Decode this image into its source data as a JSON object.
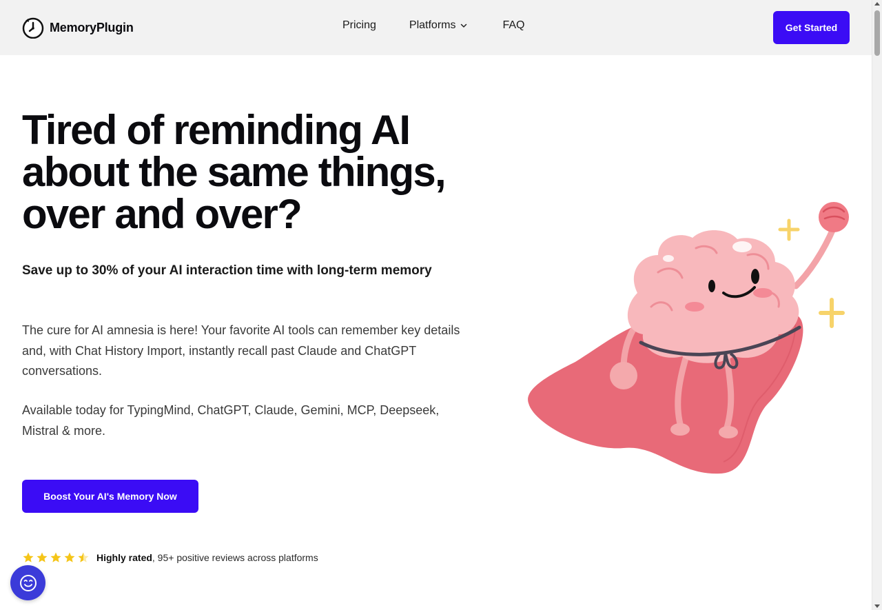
{
  "header": {
    "logo_text": "MemoryPlugin",
    "nav": {
      "pricing": "Pricing",
      "platforms": "Platforms",
      "faq": "FAQ"
    },
    "cta_label": "Get Started"
  },
  "hero": {
    "title_lines": [
      "Tired of reminding AI",
      "about the same things,",
      "over and over?"
    ],
    "subtitle": "Save up to 30% of your AI interaction time with long-term memory",
    "description": "The cure for AI amnesia is here! Your favorite AI tools can remember key details and, with Chat History Import, instantly recall past Claude and ChatGPT conversations.",
    "availability": "Available today for TypingMind, ChatGPT, Claude, Gemini, MCP, Deepseek, Mistral & more.",
    "cta_label": "Boost Your AI's Memory Now"
  },
  "rating": {
    "stars_value": 4.5,
    "stars_max": 5,
    "bold_text": "Highly rated",
    "rest_text": ", 95+ positive reviews across platforms"
  },
  "icons": {
    "logo": "stopwatch-icon",
    "platforms_chevron": "chevron-down-icon",
    "star": "star-icon",
    "chat": "smiley-chat-icon"
  },
  "colors": {
    "accent": "#3b0cf5",
    "header_bg": "#f2f2f2",
    "star": "#f5c518",
    "chat_widget": "#3b3bd9"
  }
}
